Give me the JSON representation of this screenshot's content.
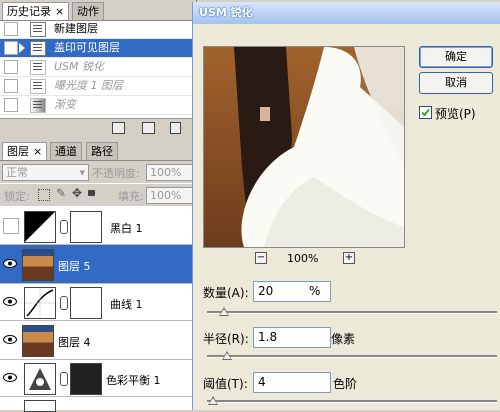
{
  "history": {
    "tabs": [
      {
        "label": "历史记录",
        "close": "×"
      },
      {
        "label": "动作"
      }
    ],
    "items": [
      {
        "label": "新建图层",
        "state": "normal"
      },
      {
        "label": "盖印可见图层",
        "state": "selected"
      },
      {
        "label": "USM 锐化",
        "state": "undone"
      },
      {
        "label": "曝光度 1 图层",
        "state": "undone"
      },
      {
        "label": "渐变",
        "state": "undone"
      }
    ]
  },
  "layers": {
    "tabs": [
      {
        "label": "图层",
        "close": "×"
      },
      {
        "label": "通道"
      },
      {
        "label": "路径"
      }
    ],
    "blend_mode": "正常",
    "opacity_label": "不透明度:",
    "opacity_value": "100%",
    "lock_label": "锁定:",
    "fill_label": "填充:",
    "fill_value": "100%",
    "items": [
      {
        "name": "黑白 1",
        "visible": false,
        "type": "adjustment-bw"
      },
      {
        "name": "图层 5",
        "visible": true,
        "type": "photo",
        "selected": true
      },
      {
        "name": "曲线 1",
        "visible": true,
        "type": "adjustment-curves"
      },
      {
        "name": "图层 4",
        "visible": true,
        "type": "photo"
      },
      {
        "name": "色彩平衡 1",
        "visible": true,
        "type": "adjustment-balance"
      }
    ]
  },
  "dialog": {
    "title": "USM 锐化",
    "ok_label": "确定",
    "cancel_label": "取消",
    "preview_label": "预览(P)",
    "preview_checked": true,
    "zoom_out": "−",
    "zoom_in": "+",
    "zoom_level": "100%",
    "params": [
      {
        "label": "数量(A):",
        "value": "20",
        "unit": "%",
        "slider": 0.06
      },
      {
        "label": "半径(R):",
        "value": "1.8",
        "unit": "像素",
        "slider": 0.07
      },
      {
        "label": "阈值(T):",
        "value": "4",
        "unit": "色阶",
        "slider": 0.02
      }
    ]
  },
  "colors": {
    "selection": "#316ac5",
    "dialog_bg": "#ece9d8",
    "panel_bg": "#d4d0c8"
  }
}
